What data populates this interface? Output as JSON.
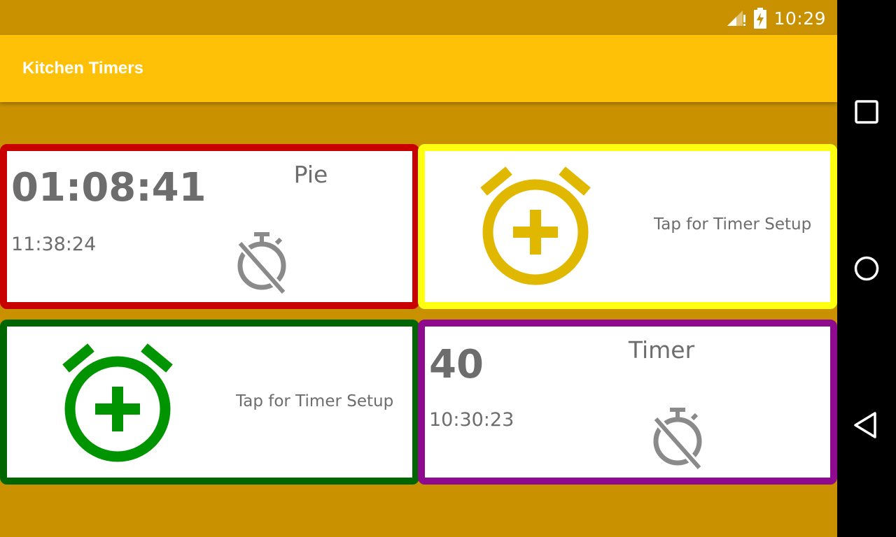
{
  "status_bar": {
    "time": "10:29",
    "icons": [
      "signal-icon",
      "battery-charging-icon"
    ]
  },
  "app_bar": {
    "title": "Kitchen Timers"
  },
  "colors": {
    "background": "#c99100",
    "app_bar": "#ffc107",
    "text": "#6d6d6d",
    "timer1_border": "#c80000",
    "timer2_border": "#ffff10",
    "timer2_icon": "#e0b800",
    "timer3_border": "#006600",
    "timer3_icon": "#009400",
    "timer4_border": "#8e0a8e"
  },
  "timers": [
    {
      "state": "running",
      "remaining": "01:08:41",
      "name": "Pie",
      "end_time": "11:38:24",
      "icon": "alarm-off-icon"
    },
    {
      "state": "empty",
      "setup_text": "Tap for Timer Setup",
      "icon": "add-alarm-icon"
    },
    {
      "state": "empty",
      "setup_text": "Tap for Timer Setup",
      "icon": "add-alarm-icon"
    },
    {
      "state": "running",
      "remaining": "40",
      "name": "Timer",
      "end_time": "10:30:23",
      "icon": "alarm-off-icon"
    }
  ],
  "nav_bar": {
    "buttons": [
      "recents-icon",
      "home-icon",
      "back-icon"
    ]
  }
}
